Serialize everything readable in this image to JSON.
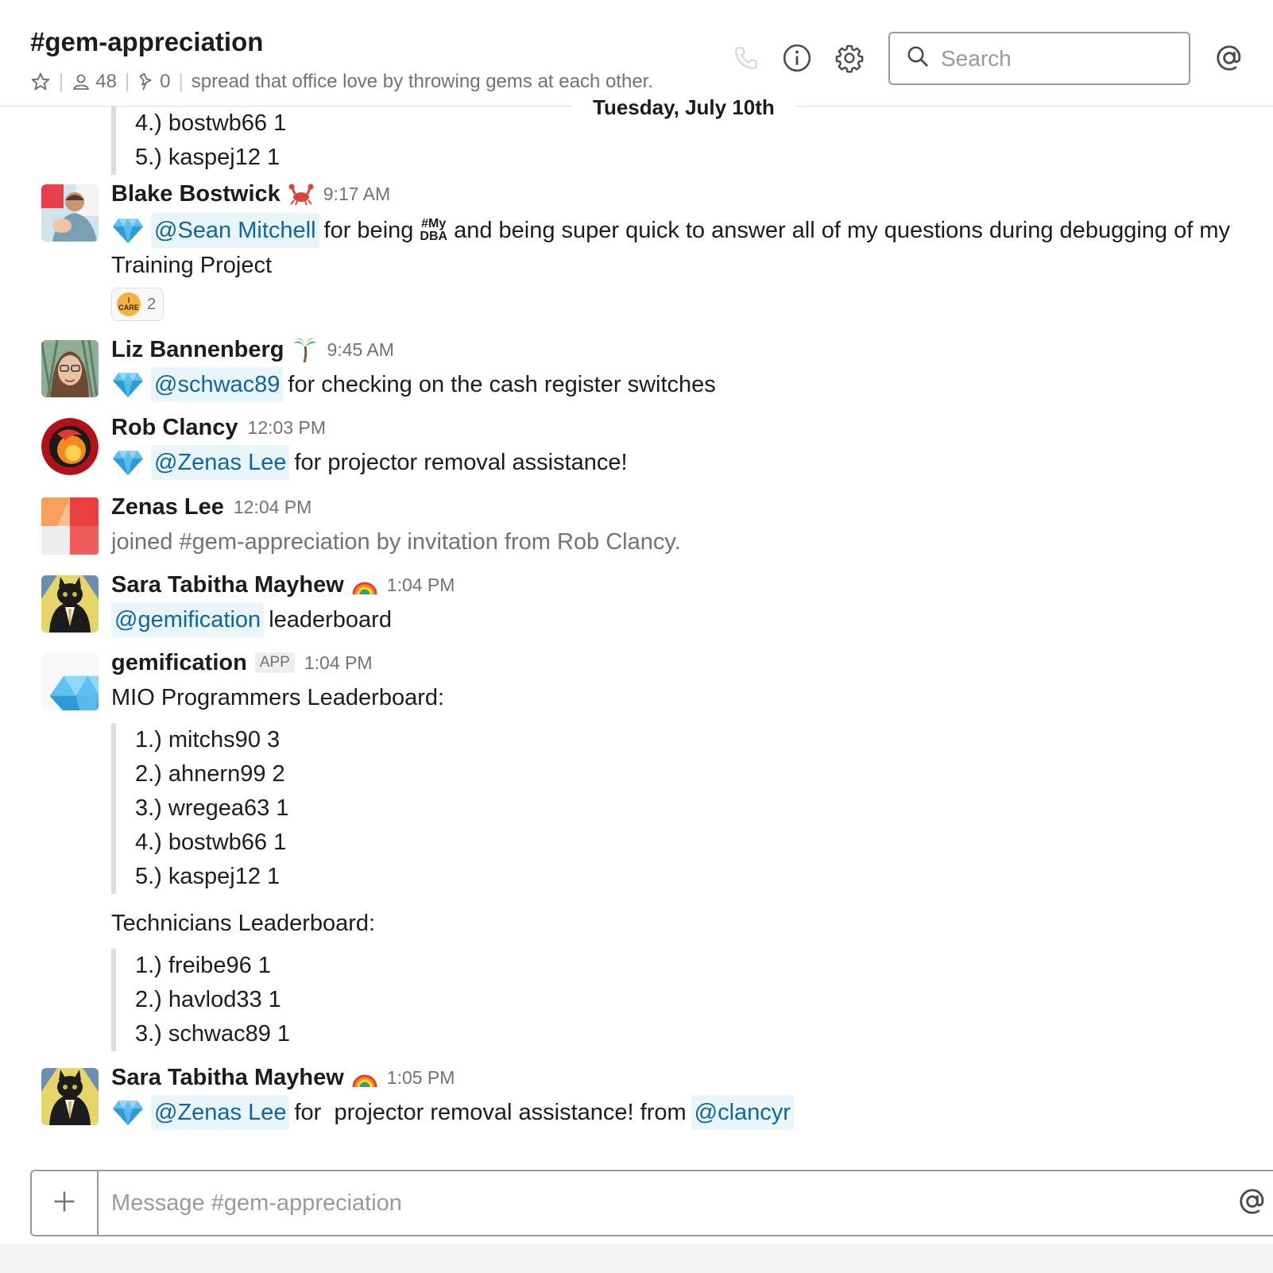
{
  "header": {
    "channel_name": "#gem-appreciation",
    "member_count": "48",
    "pinned_count": "0",
    "topic": "spread that office love by throwing gems at each other.",
    "search_placeholder": "Search",
    "icons": [
      "star-icon",
      "members-icon",
      "pin-icon",
      "phone-icon",
      "info-icon",
      "gear-icon",
      "search-icon",
      "mentions-icon"
    ]
  },
  "date_divider": "Tuesday, July 10th",
  "top_quote": [
    "4.) bostwb66 1",
    "5.) kaspej12 1"
  ],
  "messages": [
    {
      "sender": "Blake Bostwick",
      "time": "9:17 AM",
      "mention": "@Sean Mitchell",
      "text_1": "for being",
      "hashtag_top": "#My",
      "hashtag_bottom": "DBA",
      "text_2": "and being super quick to answer all of my questions during debugging of my",
      "text_3": "Training Project",
      "reaction_count": "2",
      "reaction_label_top": "I",
      "reaction_label_bottom": "CARE"
    },
    {
      "sender": "Liz Bannenberg",
      "time": "9:45 AM",
      "mention": "@schwac89",
      "text": "for checking on the cash register switches"
    },
    {
      "sender": "Rob Clancy",
      "time": "12:03 PM",
      "mention": "@Zenas Lee",
      "text": "for projector removal assistance!"
    },
    {
      "sender": "Zenas Lee",
      "time": "12:04 PM",
      "text": "joined #gem-appreciation by invitation from Rob Clancy."
    },
    {
      "sender": "Sara Tabitha Mayhew",
      "time": "1:04 PM",
      "mention": "@gemification",
      "text": "leaderboard"
    },
    {
      "sender": "gemification",
      "badge": "APP",
      "time": "1:04 PM",
      "heading_1": "MIO Programmers Leaderboard:",
      "list_1": [
        "1.) mitchs90 3",
        "2.) ahnern99 2",
        "3.) wregea63 1",
        "4.) bostwb66 1",
        "5.) kaspej12 1"
      ],
      "heading_2": "Technicians Leaderboard:",
      "list_2": [
        "1.) freibe96 1",
        "2.) havlod33 1",
        "3.) schwac89 1"
      ]
    },
    {
      "sender": "Sara Tabitha Mayhew",
      "time": "1:05 PM",
      "mention": "@Zenas Lee",
      "text_1": "for  projector removal assistance! from",
      "mention_2": "@clancyr"
    }
  ],
  "composer": {
    "placeholder": "Message #gem-appreciation"
  },
  "colors": {
    "mention_text": "#1264a3",
    "mention_bg": "#e8f5fa",
    "gem": "#3fa8e6",
    "muted": "#717274"
  }
}
